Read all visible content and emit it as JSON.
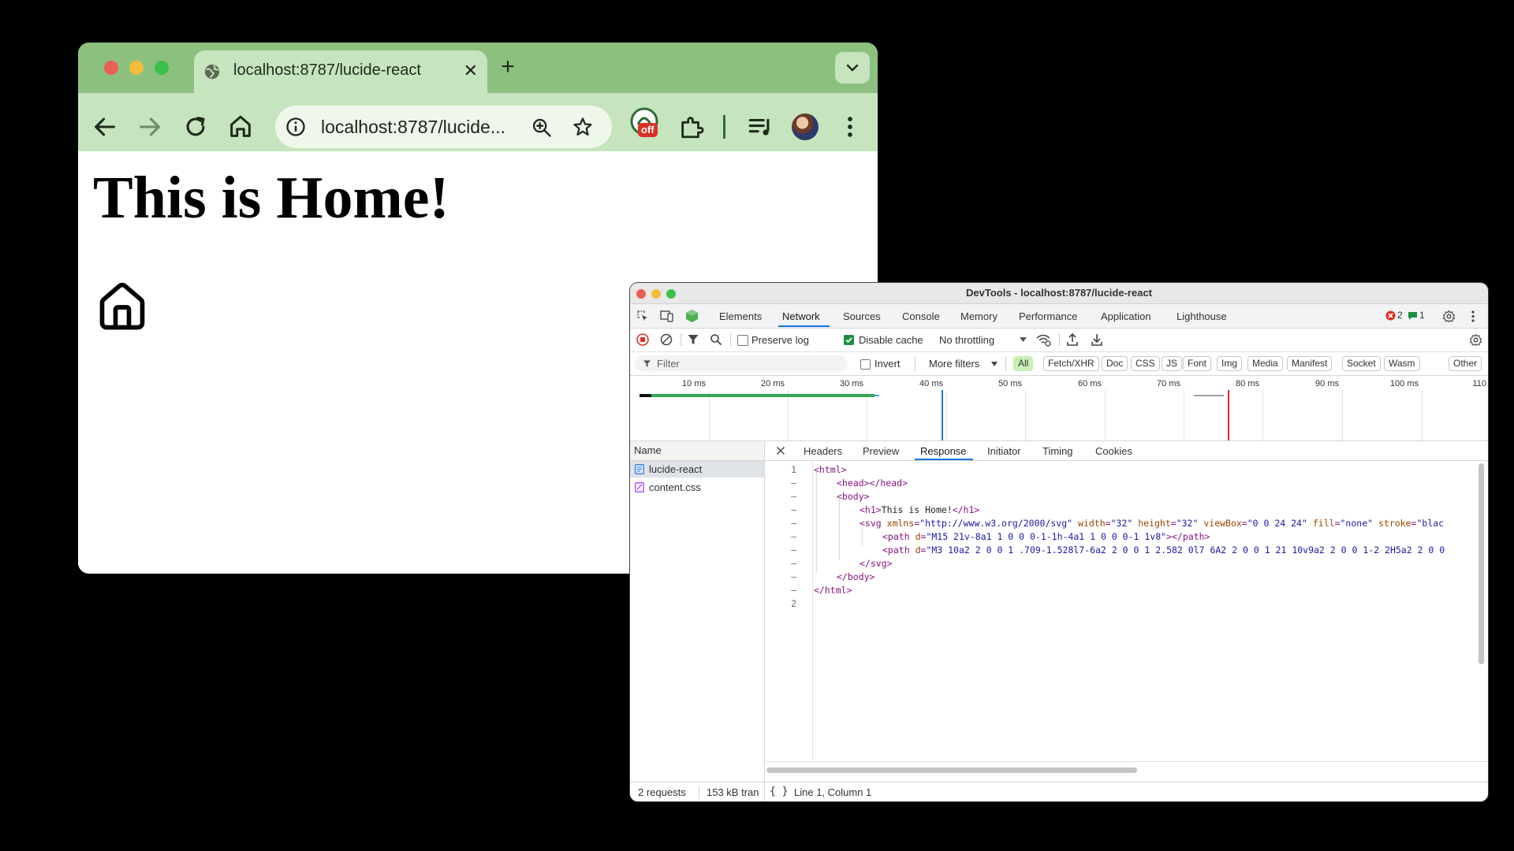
{
  "browser": {
    "tab_title": "localhost:8787/lucide-react",
    "tab_close": "✕",
    "new_tab": "+",
    "url": "localhost:8787/lucide...",
    "extension_badge": "off",
    "page_heading": "This is Home!"
  },
  "devtools": {
    "window_title": "DevTools - localhost:8787/lucide-react",
    "tabs": [
      "Elements",
      "Network",
      "Sources",
      "Console",
      "Memory",
      "Performance",
      "Application",
      "Lighthouse"
    ],
    "active_tab": "Network",
    "error_count": "2",
    "message_count": "1",
    "toolbar": {
      "preserve_log": "Preserve log",
      "disable_cache": "Disable cache",
      "throttling": "No throttling"
    },
    "filter": {
      "placeholder": "Filter",
      "invert": "Invert",
      "more_filters": "More filters",
      "types": [
        "All",
        "Fetch/XHR",
        "Doc",
        "CSS",
        "JS",
        "Font",
        "Img",
        "Media",
        "Manifest",
        "Socket",
        "Wasm",
        "Other"
      ]
    },
    "timeline_ticks": [
      "10 ms",
      "20 ms",
      "30 ms",
      "40 ms",
      "50 ms",
      "60 ms",
      "70 ms",
      "80 ms",
      "90 ms",
      "100 ms",
      "110"
    ],
    "requests_header": "Name",
    "requests": [
      "lucide-react",
      "content.css"
    ],
    "detail_tabs": [
      "Headers",
      "Preview",
      "Response",
      "Initiator",
      "Timing",
      "Cookies"
    ],
    "active_detail_tab": "Response",
    "line_numbers": [
      "1",
      "–",
      "–",
      "–",
      "–",
      "–",
      "–",
      "–",
      "–",
      "–",
      "2"
    ],
    "code": {
      "l1_tag": "<html>",
      "l2_tag": "<head></head>",
      "l3_tag": "<body>",
      "l4_open": "<h1>",
      "l4_text": "This is Home!",
      "l4_close": "</h1>",
      "l5_tag": "<svg",
      "l5_a1": "xmlns",
      "l5_v1": "\"http://www.w3.org/2000/svg\"",
      "l5_a2": "width",
      "l5_v2": "\"32\"",
      "l5_a3": "height",
      "l5_v3": "\"32\"",
      "l5_a4": "viewBox",
      "l5_v4": "\"0 0 24 24\"",
      "l5_a5": "fill",
      "l5_v5": "\"none\"",
      "l5_a6": "stroke",
      "l5_v6": "\"blac",
      "l6_tag": "<path",
      "l6_a1": "d",
      "l6_v1": "\"M15 21v-8a1 1 0 0 0-1-1h-4a1 1 0 0 0-1 1v8\"",
      "l6_close": "></path>",
      "l7_tag": "<path",
      "l7_a1": "d",
      "l7_v1": "\"M3 10a2 2 0 0 1 .709-1.528l7-6a2 2 0 0 1 2.582 0l7 6A2 2 0 0 1 21 10v9a2 2 0 0 1-2 2H5a2 2 0 0",
      "l8_tag": "</svg>",
      "l9_tag": "</body>",
      "l10_tag": "</html>",
      "eq": "="
    },
    "status": {
      "requests": "2 requests",
      "transferred": "153 kB tran",
      "braces": "{ }",
      "cursor": "Line 1, Column 1"
    },
    "colors": {
      "accent": "#1a73e8",
      "record": "#d93025",
      "error": "#d93025",
      "timeline_bar": "#34a853"
    }
  }
}
